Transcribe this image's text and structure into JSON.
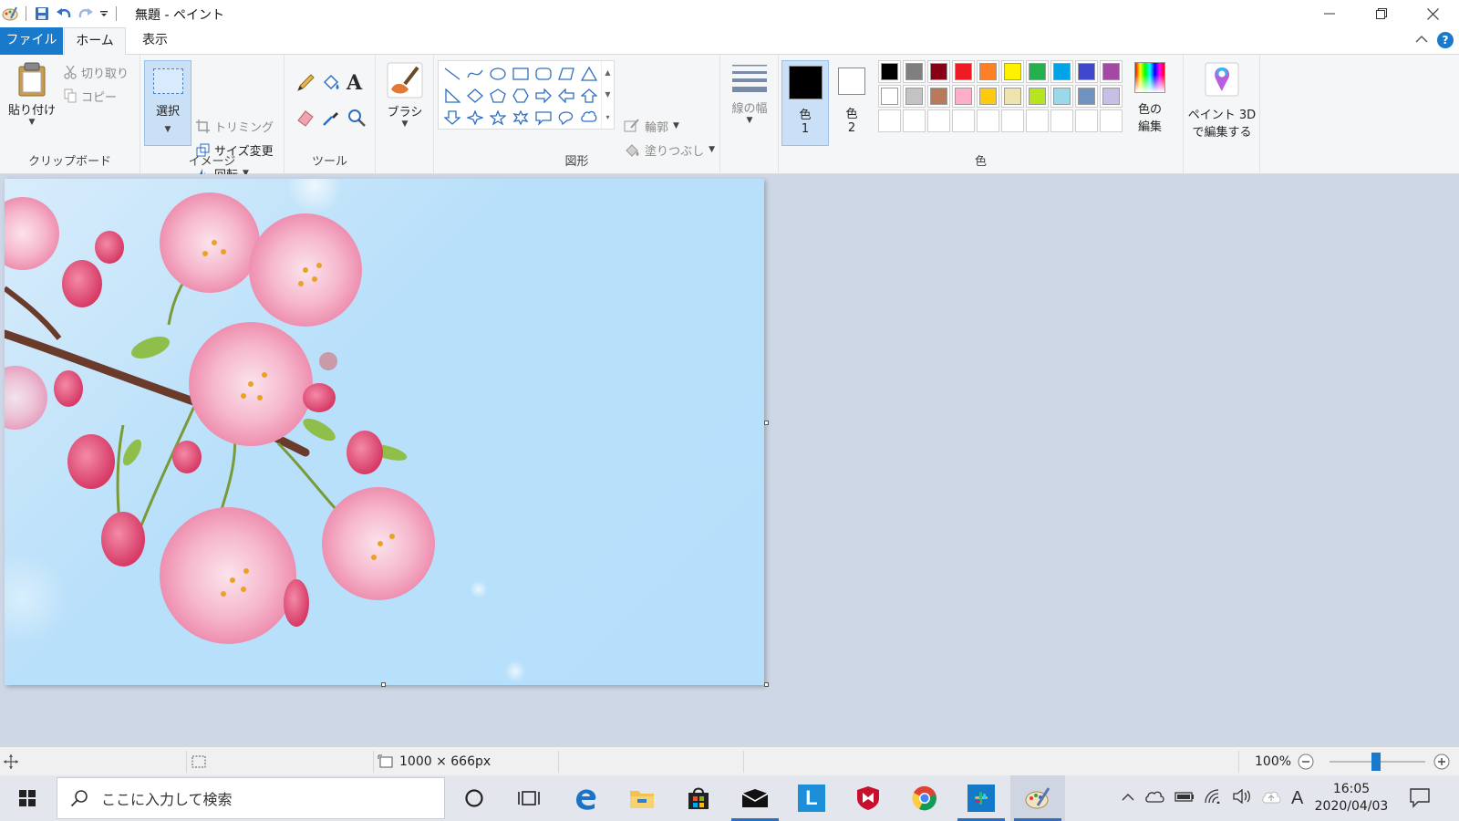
{
  "window": {
    "title": "無題 - ペイント"
  },
  "tabs": {
    "file": "ファイル",
    "home": "ホーム",
    "view": "表示"
  },
  "ribbon": {
    "clipboard": {
      "paste": "貼り付け",
      "cut": "切り取り",
      "copy": "コピー",
      "group_label": "クリップボード"
    },
    "image": {
      "select": "選択",
      "crop": "トリミング",
      "resize": "サイズ変更",
      "rotate": "回転",
      "group_label": "イメージ"
    },
    "tools": {
      "group_label": "ツール"
    },
    "brush": {
      "label": "ブラシ"
    },
    "shapes": {
      "outline": "輪郭",
      "fill": "塗りつぶし",
      "group_label": "図形"
    },
    "line_width": {
      "label": "線の幅"
    },
    "colors": {
      "color1_line1": "色",
      "color1_line2": "1",
      "color2_line1": "色",
      "color2_line2": "2",
      "edit_line1": "色の",
      "edit_line2": "編集",
      "group_label": "色",
      "color1_value": "#000000",
      "color2_value": "#ffffff",
      "palette_row1": [
        "#000000",
        "#7f7f7f",
        "#880015",
        "#ed1c24",
        "#ff7f27",
        "#fff200",
        "#22b14c",
        "#00a2e8",
        "#3f48cc",
        "#a349a4"
      ],
      "palette_row2": [
        "#ffffff",
        "#c3c3c3",
        "#b97a57",
        "#ffaec9",
        "#ffc90e",
        "#efe4b0",
        "#b5e61d",
        "#99d9ea",
        "#7092be",
        "#c8bfe7"
      ]
    },
    "paint3d": {
      "line1": "ペイント 3D",
      "line2": "で編集する"
    }
  },
  "statusbar": {
    "dimensions": "1000 × 666px",
    "zoom": "100%"
  },
  "taskbar": {
    "search_placeholder": "ここに入力して検索",
    "time": "16:05",
    "date": "2020/04/03",
    "ime": "A"
  }
}
